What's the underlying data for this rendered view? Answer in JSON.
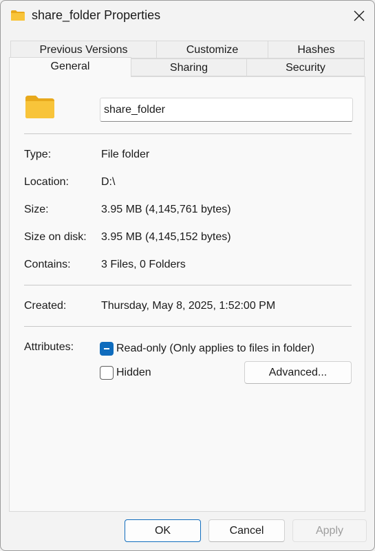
{
  "window": {
    "title": "share_folder Properties",
    "icon": "folder-icon",
    "close_icon": "close-icon"
  },
  "tabs": {
    "row_back": [
      {
        "label": "Previous Versions"
      },
      {
        "label": "Customize"
      },
      {
        "label": "Hashes"
      }
    ],
    "row_front": [
      {
        "label": "General",
        "active": true
      },
      {
        "label": "Sharing"
      },
      {
        "label": "Security"
      }
    ]
  },
  "general": {
    "folder_name": "share_folder",
    "properties": [
      {
        "label": "Type:",
        "value": "File folder"
      },
      {
        "label": "Location:",
        "value": "D:\\"
      },
      {
        "label": "Size:",
        "value": "3.95 MB (4,145,761 bytes)"
      },
      {
        "label": "Size on disk:",
        "value": "3.95 MB (4,145,152 bytes)"
      },
      {
        "label": "Contains:",
        "value": "3 Files, 0 Folders"
      }
    ],
    "created": {
      "label": "Created:",
      "value": "Thursday, May 8, 2025, 1:52:00 PM"
    },
    "attributes": {
      "label": "Attributes:",
      "readonly": {
        "label": "Read-only (Only applies to files in folder)",
        "state": "indeterminate"
      },
      "hidden": {
        "label": "Hidden",
        "state": "unchecked"
      },
      "advanced_label": "Advanced..."
    }
  },
  "footer": {
    "ok": "OK",
    "cancel": "Cancel",
    "apply": "Apply"
  },
  "colors": {
    "accent": "#0f6cbd",
    "folder_yellow": "#f8c43a",
    "folder_dark": "#e8a91c"
  }
}
